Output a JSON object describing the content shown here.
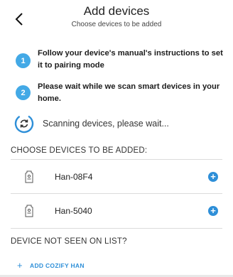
{
  "header": {
    "title": "Add devices",
    "subtitle": "Choose devices to be added"
  },
  "steps": [
    {
      "number": "1",
      "text": "Follow your device's manual's instructions to set it to pairing mode"
    },
    {
      "number": "2",
      "text": "Please wait while we scan smart devices in your home."
    }
  ],
  "scanning": {
    "text": "Scanning devices, please wait...",
    "icon": "refresh-icon"
  },
  "choose_label": "CHOOSE DEVICES TO BE ADDED:",
  "devices": [
    {
      "name": "Han-08F4",
      "icon": "device-icon",
      "action_icon": "plus-circle-icon"
    },
    {
      "name": "Han-5040",
      "icon": "device-icon",
      "action_icon": "plus-circle-icon"
    }
  ],
  "not_seen_label": "DEVICE NOT SEEN ON LIST?",
  "add_link": {
    "plus": "+",
    "label": "ADD COZIFY HAN"
  },
  "colors": {
    "accent": "#43a9e6",
    "link": "#2e8fd8",
    "divider": "#dcdcdc"
  }
}
